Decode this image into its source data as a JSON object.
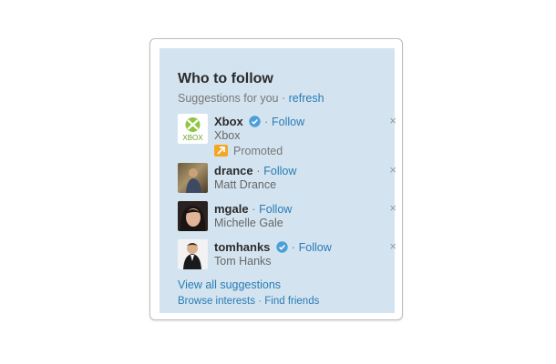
{
  "widget": {
    "title": "Who to follow",
    "subtitle": "Suggestions for you",
    "separator": "·",
    "refresh_label": "refresh"
  },
  "suggestions": [
    {
      "username": "Xbox",
      "fullname": "Xbox",
      "verified": true,
      "follow_label": "Follow",
      "promoted": true,
      "promoted_label": "Promoted",
      "close_label": "×",
      "avatar_text": "XBOX"
    },
    {
      "username": "drance",
      "fullname": "Matt Drance",
      "verified": false,
      "follow_label": "Follow",
      "promoted": false,
      "close_label": "×"
    },
    {
      "username": "mgale",
      "fullname": "Michelle Gale",
      "verified": false,
      "follow_label": "Follow",
      "promoted": false,
      "close_label": "×"
    },
    {
      "username": "tomhanks",
      "fullname": "Tom Hanks",
      "verified": true,
      "follow_label": "Follow",
      "promoted": false,
      "close_label": "×"
    }
  ],
  "footer": {
    "view_all_label": "View all suggestions",
    "browse_label": "Browse interests",
    "separator": "·",
    "find_friends_label": "Find friends"
  },
  "colors": {
    "panel_bg": "#d3e4f0",
    "link": "#2a7ab5",
    "verified": "#4a9fd8",
    "promoted": "#f5a623"
  },
  "icons": [
    "verified-badge-icon",
    "promoted-arrow-icon",
    "close-icon",
    "xbox-logo"
  ]
}
